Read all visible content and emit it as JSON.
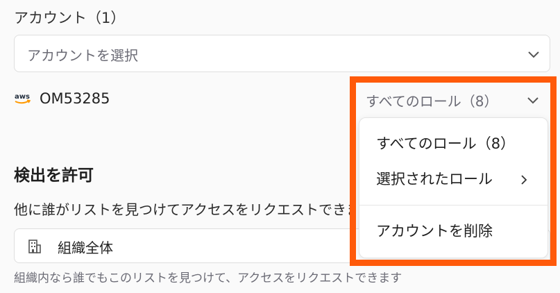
{
  "account_section": {
    "label": "アカウント（1）",
    "select_placeholder": "アカウントを選択"
  },
  "account_row": {
    "logo_text": "aws",
    "account_id": "OM53285",
    "role_select_label": "すべてのロール（8）"
  },
  "role_menu": {
    "items": [
      {
        "label": "すべてのロール（8）"
      },
      {
        "label": "選択されたロール"
      },
      {
        "label": "アカウントを削除"
      }
    ]
  },
  "detection": {
    "heading": "検出を許可",
    "description": "他に誰がリストを見つけてアクセスをリクエストできますか",
    "scope_value": "組織全体",
    "help_text": "組織内なら誰でもこのリストを見つけて、アクセスをリクエストできます"
  },
  "colors": {
    "highlight": "#ff5a0a",
    "aws_orange": "#ff9900",
    "muted_text": "#6b6b75"
  },
  "icons": {
    "dropdown": "chevron-down-icon",
    "submenu": "chevron-right-icon",
    "scope": "building-icon",
    "logo": "aws-logo"
  }
}
